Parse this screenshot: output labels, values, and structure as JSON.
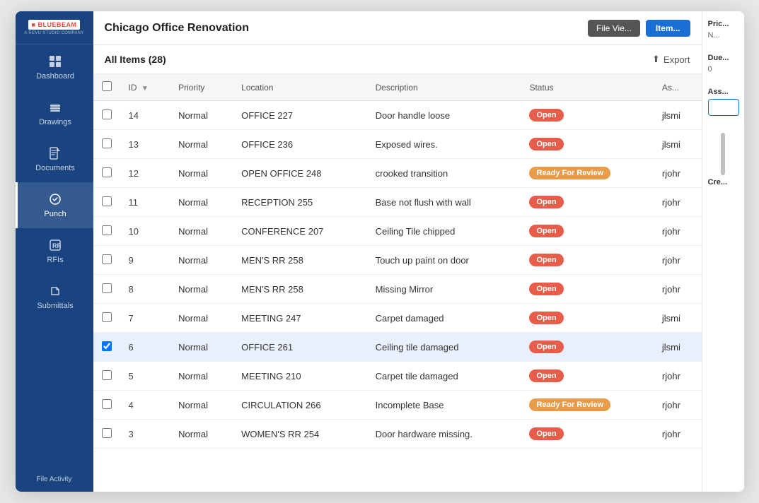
{
  "app": {
    "logo_text": "BLUEBEAM",
    "logo_sub": "A REVU STUDIO COMPANY",
    "project_title": "Chicago Office Renovation"
  },
  "sidebar": {
    "items": [
      {
        "id": "dashboard",
        "label": "Dashboard",
        "icon": "grid-icon",
        "active": false
      },
      {
        "id": "drawings",
        "label": "Drawings",
        "icon": "layers-icon",
        "active": false
      },
      {
        "id": "documents",
        "label": "Documents",
        "icon": "doc-icon",
        "active": false
      },
      {
        "id": "punch",
        "label": "Punch",
        "icon": "punch-icon",
        "active": true
      },
      {
        "id": "rfis",
        "label": "RFIs",
        "icon": "rfi-icon",
        "active": false
      },
      {
        "id": "submittals",
        "label": "Submittals",
        "icon": "submit-icon",
        "active": false
      }
    ],
    "footer": "File Activity"
  },
  "top_bar": {
    "file_view_label": "File Vie...",
    "items_label": "Item..."
  },
  "content": {
    "all_items_label": "All Items (28)",
    "export_label": "Export"
  },
  "table": {
    "columns": [
      {
        "id": "checkbox",
        "label": ""
      },
      {
        "id": "id",
        "label": "ID",
        "sortable": true
      },
      {
        "id": "priority",
        "label": "Priority"
      },
      {
        "id": "location",
        "label": "Location"
      },
      {
        "id": "description",
        "label": "Description"
      },
      {
        "id": "status",
        "label": "Status"
      },
      {
        "id": "assignee",
        "label": "As..."
      }
    ],
    "rows": [
      {
        "id": "14",
        "priority": "Normal",
        "location": "OFFICE 227",
        "description": "Door handle loose",
        "status": "Open",
        "status_type": "open",
        "assignee": "jlsmi",
        "selected": false
      },
      {
        "id": "13",
        "priority": "Normal",
        "location": "OFFICE 236",
        "description": "Exposed wires.",
        "status": "Open",
        "status_type": "open",
        "assignee": "jlsmi",
        "selected": false
      },
      {
        "id": "12",
        "priority": "Normal",
        "location": "OPEN OFFICE 248",
        "description": "crooked transition",
        "status": "Ready For Review",
        "status_type": "review",
        "assignee": "rjohr",
        "selected": false
      },
      {
        "id": "11",
        "priority": "Normal",
        "location": "RECEPTION 255",
        "description": "Base not flush with wall",
        "status": "Open",
        "status_type": "open",
        "assignee": "rjohr",
        "selected": false
      },
      {
        "id": "10",
        "priority": "Normal",
        "location": "CONFERENCE 207",
        "description": "Ceiling Tile chipped",
        "status": "Open",
        "status_type": "open",
        "assignee": "rjohr",
        "selected": false
      },
      {
        "id": "9",
        "priority": "Normal",
        "location": "MEN'S RR 258",
        "description": "Touch up paint on door",
        "status": "Open",
        "status_type": "open",
        "assignee": "rjohr",
        "selected": false
      },
      {
        "id": "8",
        "priority": "Normal",
        "location": "MEN'S RR 258",
        "description": "Missing Mirror",
        "status": "Open",
        "status_type": "open",
        "assignee": "rjohr",
        "selected": false
      },
      {
        "id": "7",
        "priority": "Normal",
        "location": "MEETING 247",
        "description": "Carpet damaged",
        "status": "Open",
        "status_type": "open",
        "assignee": "jlsmi",
        "selected": false
      },
      {
        "id": "6",
        "priority": "Normal",
        "location": "OFFICE 261",
        "description": "Ceiling tile damaged",
        "status": "Open",
        "status_type": "open",
        "assignee": "jlsmi",
        "selected": true
      },
      {
        "id": "5",
        "priority": "Normal",
        "location": "MEETING 210",
        "description": "Carpet tile damaged",
        "status": "Open",
        "status_type": "open",
        "assignee": "rjohr",
        "selected": false
      },
      {
        "id": "4",
        "priority": "Normal",
        "location": "CIRCULATION 266",
        "description": "Incomplete Base",
        "status": "Ready For Review",
        "status_type": "review",
        "assignee": "rjohr",
        "selected": false
      },
      {
        "id": "3",
        "priority": "Normal",
        "location": "WOMEN'S RR 254",
        "description": "Door hardware missing.",
        "status": "Open",
        "status_type": "open",
        "assignee": "rjohr",
        "selected": false
      }
    ]
  },
  "right_panel": {
    "price_label": "Pric...",
    "price_value": "N...",
    "due_label": "Due...",
    "due_value": "0",
    "assignee_label": "Ass...",
    "created_label": "Cre..."
  }
}
